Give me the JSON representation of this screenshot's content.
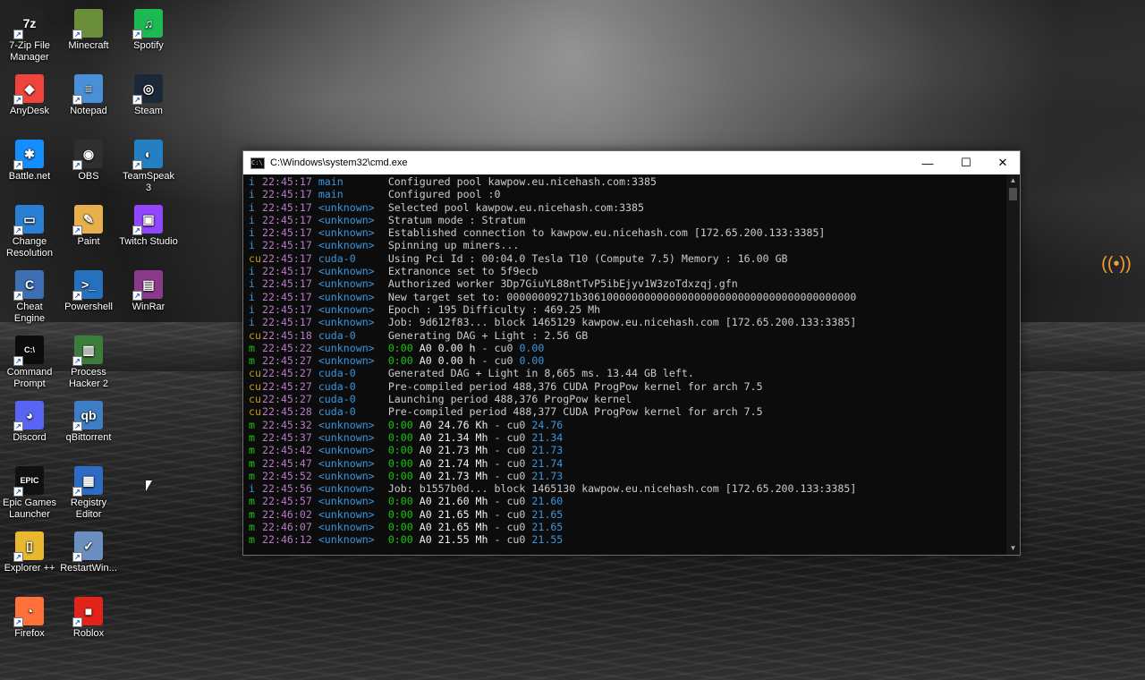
{
  "desktop": {
    "icons": [
      {
        "label": "7-Zip File Manager",
        "glyph": "7z",
        "color": "#222222"
      },
      {
        "label": "Minecraft",
        "glyph": "",
        "color": "#6b8e3a"
      },
      {
        "label": "Spotify",
        "glyph": "♫",
        "color": "#1db954"
      },
      {
        "label": "AnyDesk",
        "glyph": "◆",
        "color": "#ef443b"
      },
      {
        "label": "Notepad",
        "glyph": "≡",
        "color": "#4a90d9"
      },
      {
        "label": "Steam",
        "glyph": "◎",
        "color": "#1b2838"
      },
      {
        "label": "Battle.net",
        "glyph": "✱",
        "color": "#148eff"
      },
      {
        "label": "OBS",
        "glyph": "◉",
        "color": "#302e31"
      },
      {
        "label": "TeamSpeak 3",
        "glyph": "◐",
        "color": "#2580c3"
      },
      {
        "label": "Change Resolution",
        "glyph": "▭",
        "color": "#2a7fd4"
      },
      {
        "label": "Paint",
        "glyph": "✎",
        "color": "#e8b04a"
      },
      {
        "label": "Twitch Studio",
        "glyph": "▣",
        "color": "#9146ff"
      },
      {
        "label": "Cheat Engine",
        "glyph": "C",
        "color": "#3d6fb4"
      },
      {
        "label": "Powershell",
        "glyph": ">_",
        "color": "#2671be"
      },
      {
        "label": "WinRar",
        "glyph": "▤",
        "color": "#8b3a8b"
      },
      {
        "label": "Command Prompt",
        "glyph": "C:\\",
        "color": "#0c0c0c"
      },
      {
        "label": "Process Hacker 2",
        "glyph": "▥",
        "color": "#3c7d3c"
      },
      {
        "label": "Discord",
        "glyph": "◕",
        "color": "#5865f2"
      },
      {
        "label": "qBittorrent",
        "glyph": "qb",
        "color": "#3d7ec6"
      },
      {
        "label": "Epic Games Launcher",
        "glyph": "EPIC",
        "color": "#111111"
      },
      {
        "label": "Registry Editor",
        "glyph": "▦",
        "color": "#2d6bc4"
      },
      {
        "label": "Explorer ++",
        "glyph": "▯",
        "color": "#e8b830"
      },
      {
        "label": "RestartWin...",
        "glyph": "✓",
        "color": "#6a8fc0"
      },
      {
        "label": "Firefox",
        "glyph": "◔",
        "color": "#ff7139"
      },
      {
        "label": "Roblox",
        "glyph": "■",
        "color": "#e2231a"
      }
    ]
  },
  "window": {
    "title": "C:\\Windows\\system32\\cmd.exe",
    "minimize": "—",
    "maximize": "☐",
    "close": "✕",
    "lines": [
      {
        "lvl": "i",
        "ts": "22:45:17",
        "src": "main",
        "msg": "Configured pool kawpow.eu.nicehash.com:3385"
      },
      {
        "lvl": "i",
        "ts": "22:45:17",
        "src": "main",
        "msg": "Configured pool :0"
      },
      {
        "lvl": "i",
        "ts": "22:45:17",
        "src": "<unknown>",
        "msg": "Selected pool kawpow.eu.nicehash.com:3385"
      },
      {
        "lvl": "i",
        "ts": "22:45:17",
        "src": "<unknown>",
        "msg": "Stratum mode : Stratum"
      },
      {
        "lvl": "i",
        "ts": "22:45:17",
        "src": "<unknown>",
        "msg": "Established connection to kawpow.eu.nicehash.com [172.65.200.133:3385]"
      },
      {
        "lvl": "i",
        "ts": "22:45:17",
        "src": "<unknown>",
        "msg": "Spinning up miners..."
      },
      {
        "lvl": "cu",
        "ts": "22:45:17",
        "src": "cuda-0",
        "msg": "Using Pci Id : 00:04.0 Tesla T10 (Compute 7.5) Memory : 16.00 GB"
      },
      {
        "lvl": "i",
        "ts": "22:45:17",
        "src": "<unknown>",
        "msg": "Extranonce set to 5f9ecb"
      },
      {
        "lvl": "i",
        "ts": "22:45:17",
        "src": "<unknown>",
        "msg": "Authorized worker 3Dp7GiuYL88ntTvP5ibEjyv1W3zoTdxzqj.gfn"
      },
      {
        "lvl": "i",
        "ts": "22:45:17",
        "src": "<unknown>",
        "msg": "New target set to: 00000009271b30610000000000000000000000000000000000000000"
      },
      {
        "lvl": "i",
        "ts": "22:45:17",
        "src": "<unknown>",
        "msg": "Epoch : 195 Difficulty : 469.25 Mh"
      },
      {
        "lvl": "i",
        "ts": "22:45:17",
        "src": "<unknown>",
        "msg": "Job: 9d612f83... block 1465129 kawpow.eu.nicehash.com [172.65.200.133:3385]"
      },
      {
        "lvl": "cu",
        "ts": "22:45:18",
        "src": "cuda-0",
        "msg": "Generating DAG + Light : 2.56 GB"
      },
      {
        "lvl": "m",
        "ts": "22:45:22",
        "src": "<unknown>",
        "time": "0:00",
        "rate": "A0 0.00 h",
        "dev": "cu0",
        "val": "0.00"
      },
      {
        "lvl": "m",
        "ts": "22:45:27",
        "src": "<unknown>",
        "time": "0:00",
        "rate": "A0 0.00 h",
        "dev": "cu0",
        "val": "0.00"
      },
      {
        "lvl": "cu",
        "ts": "22:45:27",
        "src": "cuda-0",
        "msg": "Generated DAG + Light in 8,665 ms. 13.44 GB left."
      },
      {
        "lvl": "cu",
        "ts": "22:45:27",
        "src": "cuda-0",
        "msg": "Pre-compiled period 488,376 CUDA ProgPow kernel for arch 7.5"
      },
      {
        "lvl": "cu",
        "ts": "22:45:27",
        "src": "cuda-0",
        "msg": "Launching period 488,376 ProgPow kernel"
      },
      {
        "lvl": "cu",
        "ts": "22:45:28",
        "src": "cuda-0",
        "msg": "Pre-compiled period 488,377 CUDA ProgPow kernel for arch 7.5"
      },
      {
        "lvl": "m",
        "ts": "22:45:32",
        "src": "<unknown>",
        "time": "0:00",
        "rate": "A0 24.76 Kh",
        "dev": "cu0",
        "val": "24.76"
      },
      {
        "lvl": "m",
        "ts": "22:45:37",
        "src": "<unknown>",
        "time": "0:00",
        "rate": "A0 21.34 Mh",
        "dev": "cu0",
        "val": "21.34"
      },
      {
        "lvl": "m",
        "ts": "22:45:42",
        "src": "<unknown>",
        "time": "0:00",
        "rate": "A0 21.73 Mh",
        "dev": "cu0",
        "val": "21.73"
      },
      {
        "lvl": "m",
        "ts": "22:45:47",
        "src": "<unknown>",
        "time": "0:00",
        "rate": "A0 21.74 Mh",
        "dev": "cu0",
        "val": "21.74"
      },
      {
        "lvl": "m",
        "ts": "22:45:52",
        "src": "<unknown>",
        "time": "0:00",
        "rate": "A0 21.73 Mh",
        "dev": "cu0",
        "val": "21.73"
      },
      {
        "lvl": "i",
        "ts": "22:45:56",
        "src": "<unknown>",
        "msg": "Job: b1557b0d... block 1465130 kawpow.eu.nicehash.com [172.65.200.133:3385]"
      },
      {
        "lvl": "m",
        "ts": "22:45:57",
        "src": "<unknown>",
        "time": "0:00",
        "rate": "A0 21.60 Mh",
        "dev": "cu0",
        "val": "21.60"
      },
      {
        "lvl": "m",
        "ts": "22:46:02",
        "src": "<unknown>",
        "time": "0:00",
        "rate": "A0 21.65 Mh",
        "dev": "cu0",
        "val": "21.65"
      },
      {
        "lvl": "m",
        "ts": "22:46:07",
        "src": "<unknown>",
        "time": "0:00",
        "rate": "A0 21.65 Mh",
        "dev": "cu0",
        "val": "21.65"
      },
      {
        "lvl": "m",
        "ts": "22:46:12",
        "src": "<unknown>",
        "time": "0:00",
        "rate": "A0 21.55 Mh",
        "dev": "cu0",
        "val": "21.55"
      }
    ]
  },
  "tray": {
    "icon": "broadcast-icon",
    "color": "#f0a030"
  }
}
